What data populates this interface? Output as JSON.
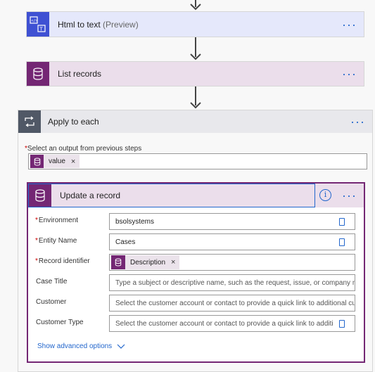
{
  "steps": {
    "html_to_text": {
      "title": "Html to text",
      "badge": "(Preview)",
      "icon": "html-to-text-icon",
      "color": "#3f51d3"
    },
    "list_records": {
      "title": "List records",
      "icon": "database-icon",
      "color": "#742774"
    },
    "apply_to_each": {
      "title": "Apply to each",
      "icon": "loop-icon",
      "select_label": "Select an output from previous steps",
      "token": "value"
    }
  },
  "update_record": {
    "title": "Update a record",
    "fields": [
      {
        "label": "Environment",
        "required": "*",
        "value": "bsolsystems",
        "kind": "text"
      },
      {
        "label": "Entity Name",
        "required": "*",
        "value": "Cases",
        "kind": "text"
      },
      {
        "label": "Record identifier",
        "required": "*",
        "value": "Description",
        "kind": "token"
      },
      {
        "label": "Case Title",
        "required": "",
        "value": "Type a subject or descriptive name, such as the request, issue, or company name",
        "kind": "placeholder"
      },
      {
        "label": "Customer",
        "required": "",
        "value": "Select the customer account or contact to provide a quick link to additional customer details",
        "kind": "placeholder"
      },
      {
        "label": "Customer Type",
        "required": "",
        "value": "Select the customer account or contact to provide a quick link to additional customer details",
        "kind": "placeholder"
      }
    ],
    "advanced": "Show advanced options"
  },
  "colors": {
    "accent": "#2266cc",
    "dataverse": "#742774",
    "html": "#3f51d3"
  }
}
